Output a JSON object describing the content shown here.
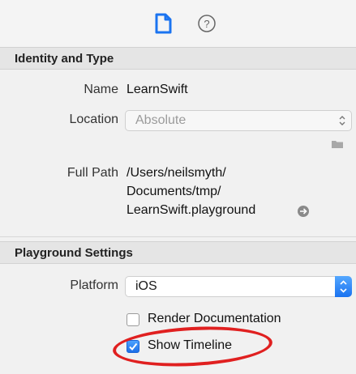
{
  "toolbar": {
    "icons": [
      "file-icon",
      "help-icon"
    ]
  },
  "identity_section": {
    "header": "Identity and Type",
    "name_label": "Name",
    "name_value": "LearnSwift",
    "location_label": "Location",
    "location_value": "Absolute",
    "full_path_label": "Full Path",
    "full_path_line1": "/Users/neilsmyth/",
    "full_path_line2": "Documents/tmp/",
    "full_path_line3": "LearnSwift.playground"
  },
  "playground_section": {
    "header": "Playground Settings",
    "platform_label": "Platform",
    "platform_value": "iOS",
    "render_docs_label": "Render Documentation",
    "render_docs_checked": false,
    "show_timeline_label": "Show Timeline",
    "show_timeline_checked": true
  },
  "colors": {
    "accent": "#1a73f0",
    "highlight_oval": "#e02020"
  }
}
